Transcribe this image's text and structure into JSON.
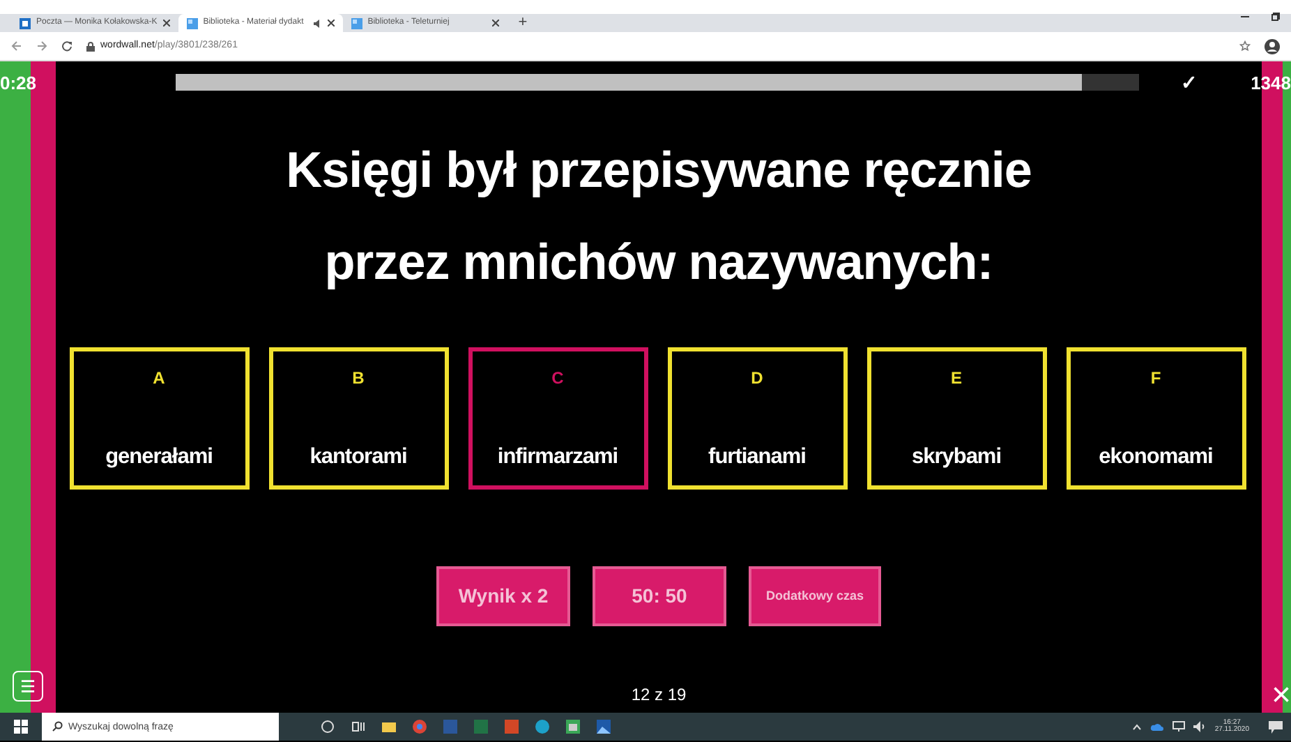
{
  "browser": {
    "tabs": [
      {
        "title": "Poczta — Monika Kołakowska-K",
        "selected": false,
        "audio": false
      },
      {
        "title": "Biblioteka - Materiał dydakt",
        "selected": true,
        "audio": true
      },
      {
        "title": "Biblioteka - Teleturniej",
        "selected": false,
        "audio": false
      }
    ],
    "new_tab": "+",
    "url_host": "wordwall.net",
    "url_path": "/play/3801/238/261"
  },
  "game": {
    "timer": "0:28",
    "progress": {
      "level": 0.94
    },
    "check": "✓",
    "score": "1348",
    "question": [
      "Księgi był przepisywane ręcznie",
      "przez mnichów nazywanych:"
    ],
    "answers": [
      {
        "letter": "A",
        "text": "generałami",
        "selected": false
      },
      {
        "letter": "B",
        "text": "kantorami",
        "selected": false
      },
      {
        "letter": "C",
        "text": "infirmarzami",
        "selected": true
      },
      {
        "letter": "D",
        "text": "furtianami",
        "selected": false
      },
      {
        "letter": "E",
        "text": "skrybami",
        "selected": false
      },
      {
        "letter": "F",
        "text": "ekonomami",
        "selected": false
      }
    ],
    "powerups": [
      {
        "label": "Wynik x 2",
        "kind": "large"
      },
      {
        "label": "50: 50",
        "kind": "large"
      },
      {
        "label": "Dodatkowy czas",
        "kind": "small"
      }
    ],
    "counter": "12 z 19",
    "close": "×"
  },
  "taskbar": {
    "search": {
      "placeholder": "Wyszukaj dowolną frazę"
    },
    "time": "16:27",
    "date": "27.11.2020"
  }
}
